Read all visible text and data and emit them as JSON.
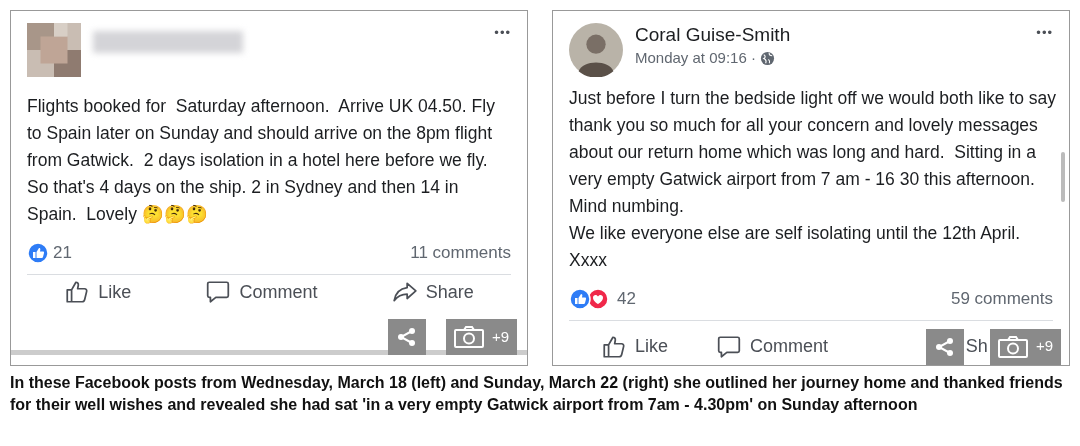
{
  "posts": [
    {
      "body": "Flights booked for  Saturday afternoon.  Arrive UK 04.50. Fly to Spain later on Sunday and should arrive on the 8pm flight from Gatwick.  2 days isolation in a hotel here before we fly.  So that's 4 days on the ship. 2 in Sydney and then 14 in Spain.  Lovely 🤔🤔🤔",
      "more": "•••",
      "reactions": [
        {
          "kind": "like"
        }
      ],
      "reaction_count": "21",
      "comments": "11 comments",
      "actions": [
        {
          "kind": "like",
          "label": "Like"
        },
        {
          "kind": "comment",
          "label": "Comment"
        },
        {
          "kind": "share",
          "label": "Share"
        }
      ],
      "photo_count": "+9"
    },
    {
      "author": "Coral Guise-Smith",
      "timestamp": "Monday at 09:16 ·",
      "body": "Just before I turn the bedside light off we would both like to say thank you so much for all your concern and lovely messages about our return home which was long and hard.  Sitting in a very empty Gatwick airport from 7 am - 16 30 this afternoon.  Mind numbing.\nWe like everyone else are self isolating until the 12th April. Xxxx",
      "more": "•••",
      "reactions": [
        {
          "kind": "like"
        },
        {
          "kind": "love"
        }
      ],
      "reaction_count": "42",
      "comments": "59 comments",
      "actions": [
        {
          "kind": "like",
          "label": "Like"
        },
        {
          "kind": "comment",
          "label": "Comment"
        },
        {
          "kind": "share",
          "label": "Sh"
        }
      ],
      "photo_count": "+9",
      "scrollbar": true
    }
  ],
  "caption": "In these Facebook posts from Wednesday, March 18 (left) and Sunday, March 22 (right) she outlined her journey home and thanked friends for their well wishes and revealed she had sat 'in a very empty Gatwick airport from 7am - 4.30pm' on Sunday afternoon"
}
